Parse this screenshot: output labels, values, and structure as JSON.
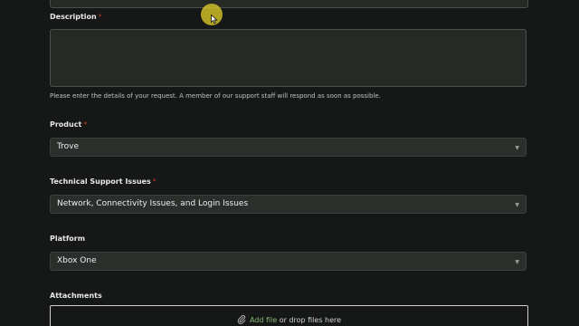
{
  "form": {
    "description": {
      "label": "Description",
      "required_mark": "*",
      "value": "",
      "helper": "Please enter the details of your request. A member of our support staff will respond as soon as possible."
    },
    "product": {
      "label": "Product",
      "required_mark": "*",
      "selected": "Trove"
    },
    "technical_support_issues": {
      "label": "Technical Support Issues",
      "required_mark": "*",
      "selected": "Network, Connectivity Issues, and Login Issues"
    },
    "platform": {
      "label": "Platform",
      "selected": "Xbox One"
    },
    "attachments": {
      "label": "Attachments",
      "add_file_label": "Add file",
      "drop_text": " or drop files here"
    }
  },
  "icons": {
    "dropdown_caret": "caret-down-icon",
    "attach": "paperclip-icon"
  },
  "colors": {
    "background": "#151816",
    "field_background": "#2a2f2c",
    "required": "#c0392b",
    "link": "#8ab87a",
    "cursor_highlight": "#e6d228"
  }
}
